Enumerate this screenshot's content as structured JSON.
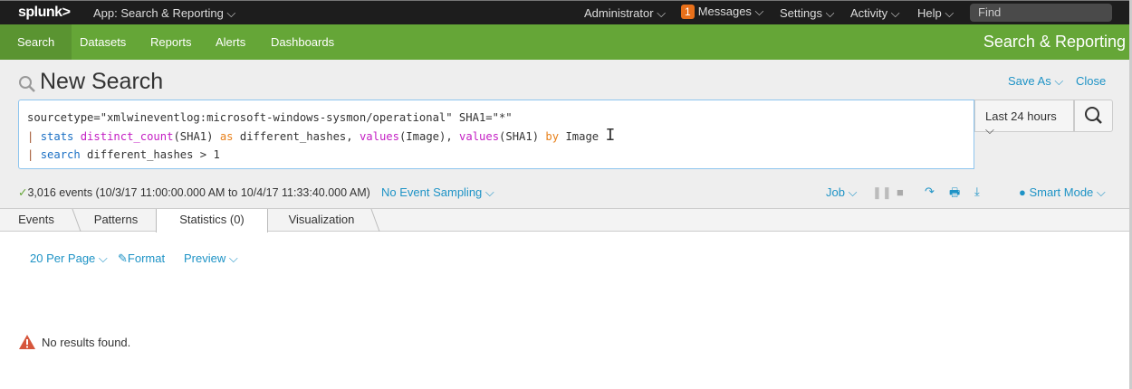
{
  "topbar": {
    "logo": "splunk>",
    "app": "App: Search & Reporting",
    "items": [
      "Administrator",
      "Messages",
      "Settings",
      "Activity",
      "Help"
    ],
    "messages_count": "1",
    "find_placeholder": "Find"
  },
  "appnav": {
    "items": [
      "Search",
      "Datasets",
      "Reports",
      "Alerts",
      "Dashboards"
    ],
    "app_title": "Search & Reporting"
  },
  "search": {
    "title": "New Search",
    "save_as": "Save As",
    "close": "Close",
    "time_range": "Last 24 hours",
    "query": {
      "l1": "sourcetype=\"xmlwineventlog:microsoft-windows-sysmon/operational\" SHA1=\"*\"",
      "pipe": "|",
      "stats": "stats",
      "distinct_count": "distinct_count",
      "a1": "(SHA1) ",
      "as": "as",
      "a2": " different_hashes, ",
      "values": "values",
      "a3": "(Image), ",
      "a4": "(SHA1) ",
      "by": "by",
      "a5": " Image",
      "search": "search",
      "a6": " different_hashes > 1"
    }
  },
  "status": {
    "events": "3,016 events (10/3/17 11:00:00.000 AM to 10/4/17 11:33:40.000 AM)",
    "sampling": "No Event Sampling",
    "job": "Job",
    "mode": "Smart Mode"
  },
  "tabs": [
    "Events",
    "Patterns",
    "Statistics (0)",
    "Visualization"
  ],
  "results": {
    "per_page": "20 Per Page",
    "format": "Format",
    "preview": "Preview",
    "message": "No results found."
  }
}
